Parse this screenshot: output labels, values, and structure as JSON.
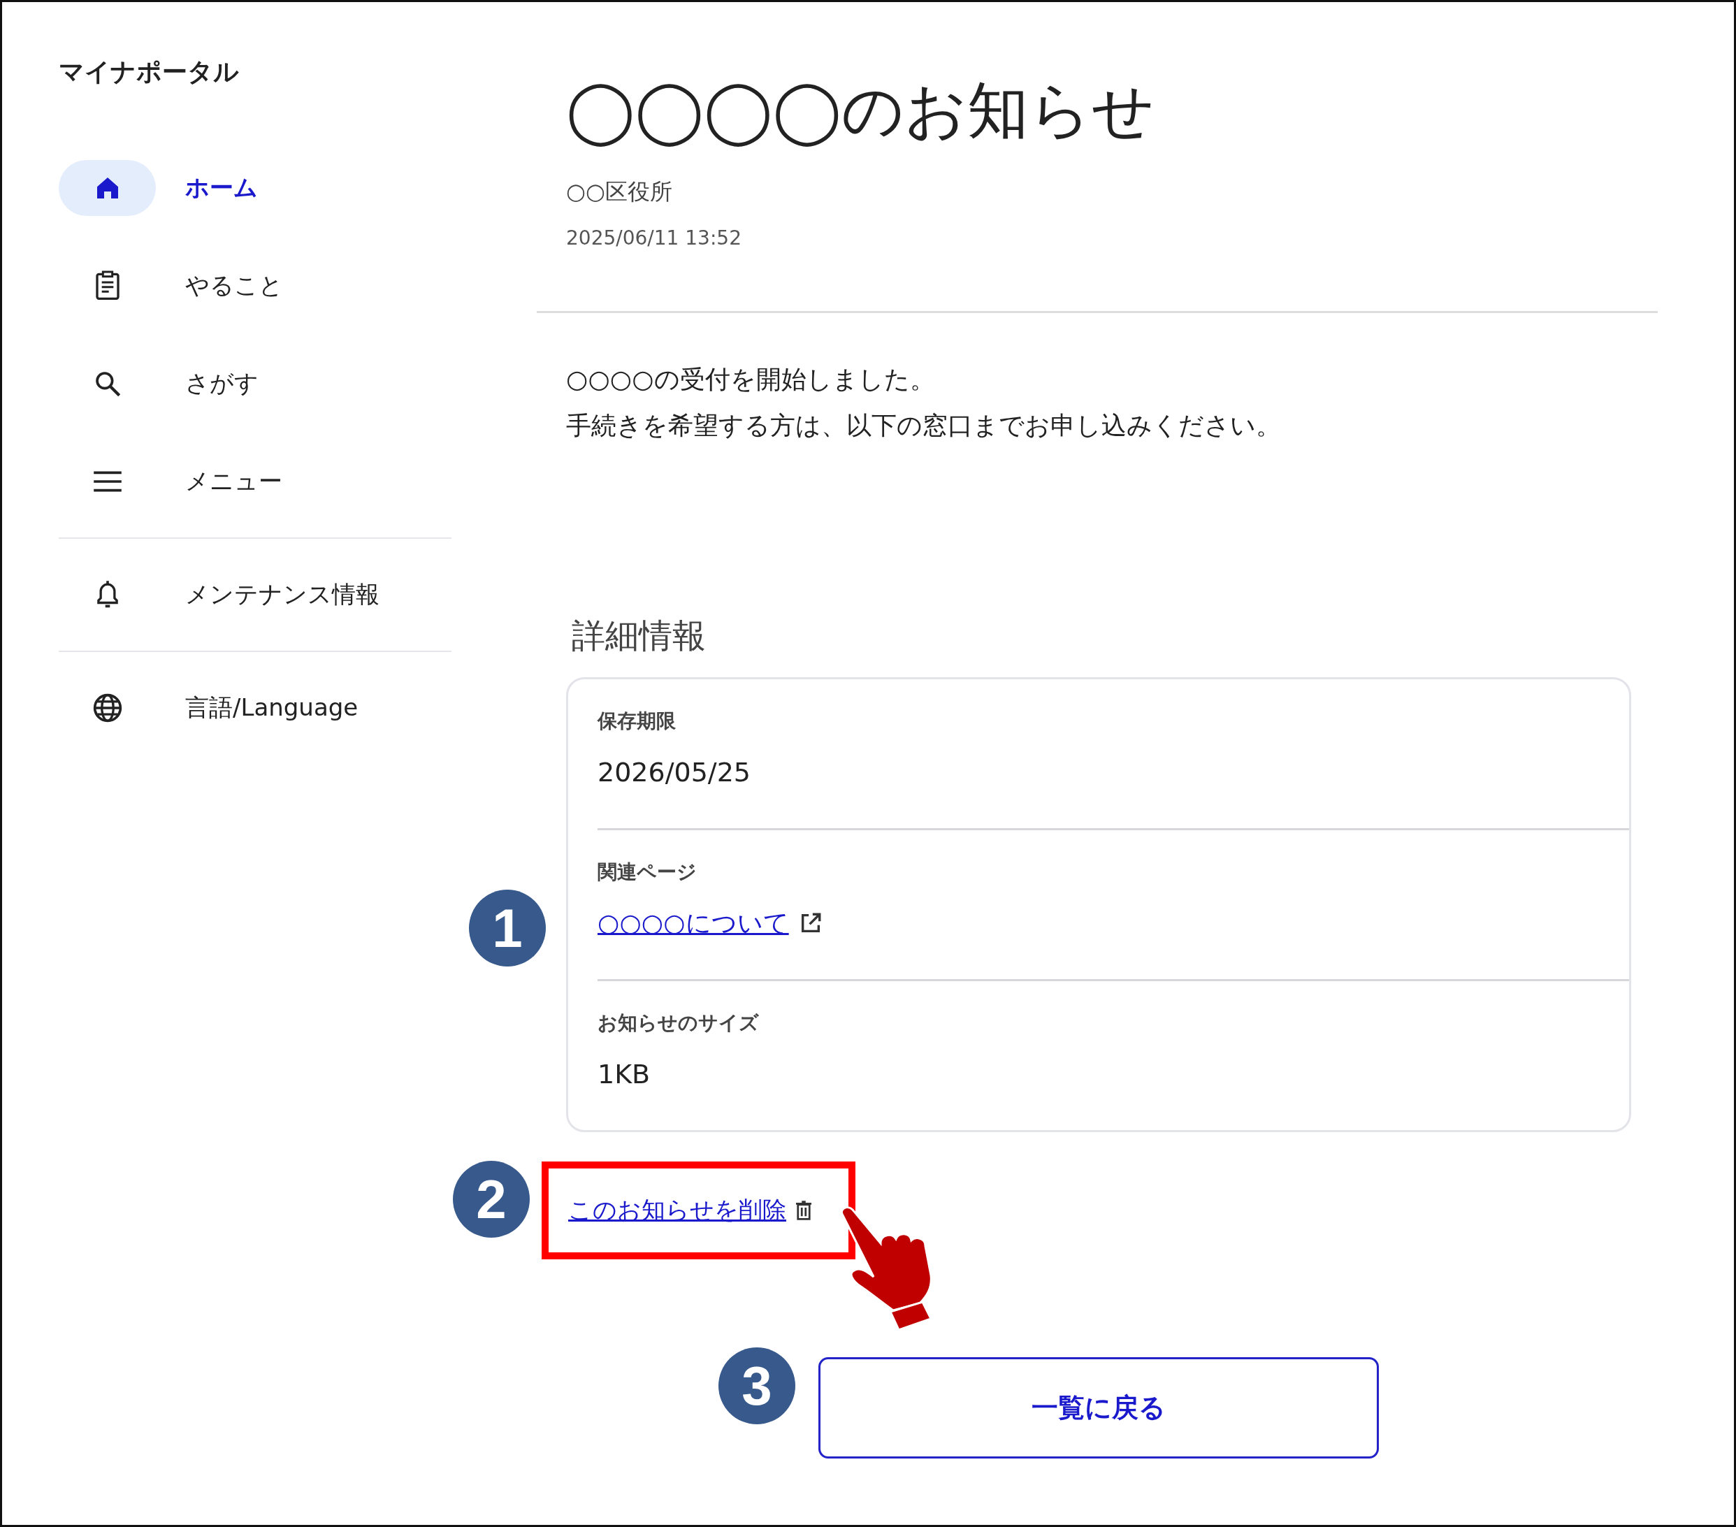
{
  "sidebar": {
    "logo": "マイナポータル",
    "groups": [
      [
        {
          "label": "ホーム",
          "selected": true
        },
        {
          "label": "やること",
          "selected": false
        },
        {
          "label": "さがす",
          "selected": false
        },
        {
          "label": "メニュー",
          "selected": false
        }
      ],
      [
        {
          "label": "メンテナンス情報",
          "selected": false
        }
      ],
      [
        {
          "label": "言語/Language",
          "selected": false
        }
      ]
    ]
  },
  "notice": {
    "title": "◯◯◯◯のお知らせ",
    "sender": "○○区役所",
    "datetime": "2025/06/11 13:52",
    "body": [
      "○○○○の受付を開始しました。",
      "手続きを希望する方は、以下の窓口までお申し込みください。"
    ],
    "details_heading": "詳細情報",
    "details": [
      {
        "kind": "text",
        "label": "保存期限",
        "value": "2026/05/25"
      },
      {
        "kind": "link",
        "label": "関連ページ",
        "value": "○○○○について"
      },
      {
        "kind": "text",
        "label": "お知らせのサイズ",
        "value": "1KB"
      }
    ],
    "delete_link": "このお知らせを削除",
    "back_button": "一覧に戻る"
  },
  "annotations": [
    {
      "number": "1"
    },
    {
      "number": "2"
    },
    {
      "number": "3"
    }
  ]
}
